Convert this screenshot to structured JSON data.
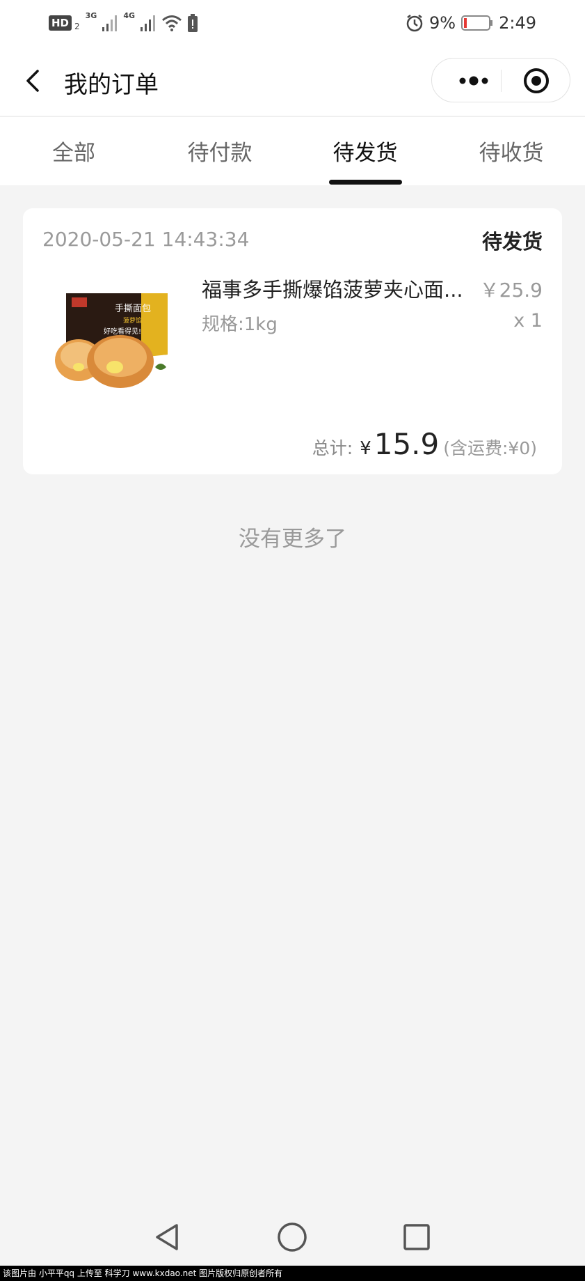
{
  "status_bar": {
    "hd_label": "HD",
    "hd_sub": "2",
    "net1_label": "3G",
    "net2_label": "4G",
    "battery_pct": "9%",
    "time": "2:49"
  },
  "header": {
    "title": "我的订单",
    "icons": [
      "back-icon",
      "more-icon",
      "target-icon"
    ]
  },
  "tabs": [
    {
      "label": "全部",
      "active": false
    },
    {
      "label": "待付款",
      "active": false
    },
    {
      "label": "待发货",
      "active": true
    },
    {
      "label": "待收货",
      "active": false
    }
  ],
  "order": {
    "time": "2020-05-21 14:43:34",
    "status": "待发货",
    "product_name": "福事多手撕爆馅菠萝夹心面...",
    "price": "￥25.9",
    "spec": "规格:1kg",
    "quantity": "x 1",
    "total_label": "总计:",
    "total_currency": "¥",
    "total_amount": "15.9",
    "shipping_note": "(含运费:¥0)",
    "thumb_box_text": "手撕面包 菠萝馅 好吃看得见!"
  },
  "footer_note": "没有更多了",
  "watermark": "该图片由 小平平qq 上传至 科学刀 www.kxdao.net 图片版权归原创者所有",
  "colors": {
    "background": "#f4f4f4",
    "card": "#ffffff",
    "active_tab": "#111111",
    "muted": "#999999",
    "battery_low": "#e53935"
  }
}
